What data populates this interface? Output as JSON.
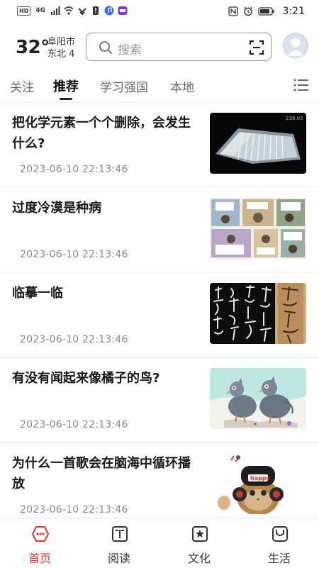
{
  "status_bar": {
    "left_chips": [
      "HD",
      "4G"
    ],
    "time": "3:21",
    "icons": [
      "signal-icon",
      "wifi-icon",
      "vibrate-icon",
      "battery-warning-icon",
      "music-app-icon",
      "app-notify-icon",
      "nfc-icon",
      "alarm-icon",
      "battery-icon"
    ]
  },
  "header": {
    "temperature": "32°",
    "city": "阜阳市",
    "wind": "东北 4",
    "search_placeholder": "搜索"
  },
  "tabs": [
    {
      "label": "关注",
      "active": false
    },
    {
      "label": "推荐",
      "active": true
    },
    {
      "label": "学习强国",
      "active": false
    },
    {
      "label": "本地",
      "active": false
    }
  ],
  "feed": [
    {
      "title": "把化学元素一个个删除，会发生什么?",
      "time": "2023-06-10 22:13:46",
      "thumb": "crystal-photo"
    },
    {
      "title": "过度冷漠是种病",
      "time": "2023-06-10 22:13:46",
      "thumb": "comic-panels"
    },
    {
      "title": "临摹一临",
      "time": "2023-06-10 22:13:46",
      "thumb": "calligraphy"
    },
    {
      "title": "有没有闻起来像橘子的鸟?",
      "time": "2023-06-10 22:13:46",
      "thumb": "pigeons-illustration"
    },
    {
      "title": "为什么一首歌会在脑海中循环播放",
      "time": "2023-06-10 22:13:46",
      "thumb": "cat-headphones",
      "thumb_text": "happy"
    }
  ],
  "thumb_overlay": "238.03",
  "bottom_nav": [
    {
      "label": "首页",
      "icon": "home-icon",
      "active": true
    },
    {
      "label": "阅读",
      "icon": "book-icon",
      "active": false
    },
    {
      "label": "文化",
      "icon": "culture-icon",
      "active": false
    },
    {
      "label": "生活",
      "icon": "life-icon",
      "active": false
    }
  ],
  "colors": {
    "accent": "#d6393b",
    "text": "#1a1a1a",
    "muted": "#8a8a8a"
  }
}
